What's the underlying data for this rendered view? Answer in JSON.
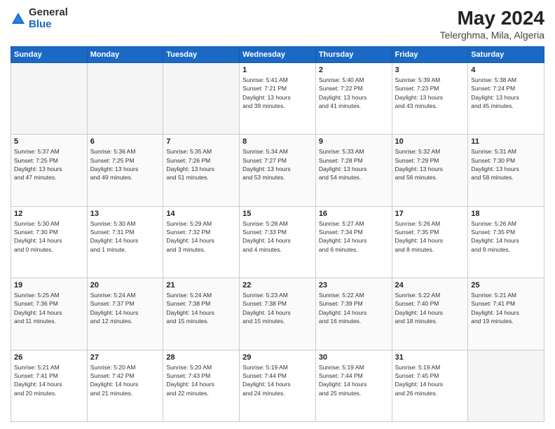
{
  "logo": {
    "general": "General",
    "blue": "Blue"
  },
  "title": "May 2024",
  "subtitle": "Telerghma, Mila, Algeria",
  "weekdays": [
    "Sunday",
    "Monday",
    "Tuesday",
    "Wednesday",
    "Thursday",
    "Friday",
    "Saturday"
  ],
  "weeks": [
    [
      {
        "day": "",
        "info": ""
      },
      {
        "day": "",
        "info": ""
      },
      {
        "day": "",
        "info": ""
      },
      {
        "day": "1",
        "info": "Sunrise: 5:41 AM\nSunset: 7:21 PM\nDaylight: 13 hours\nand 39 minutes."
      },
      {
        "day": "2",
        "info": "Sunrise: 5:40 AM\nSunset: 7:22 PM\nDaylight: 13 hours\nand 41 minutes."
      },
      {
        "day": "3",
        "info": "Sunrise: 5:39 AM\nSunset: 7:23 PM\nDaylight: 13 hours\nand 43 minutes."
      },
      {
        "day": "4",
        "info": "Sunrise: 5:38 AM\nSunset: 7:24 PM\nDaylight: 13 hours\nand 45 minutes."
      }
    ],
    [
      {
        "day": "5",
        "info": "Sunrise: 5:37 AM\nSunset: 7:25 PM\nDaylight: 13 hours\nand 47 minutes."
      },
      {
        "day": "6",
        "info": "Sunrise: 5:36 AM\nSunset: 7:25 PM\nDaylight: 13 hours\nand 49 minutes."
      },
      {
        "day": "7",
        "info": "Sunrise: 5:35 AM\nSunset: 7:26 PM\nDaylight: 13 hours\nand 51 minutes."
      },
      {
        "day": "8",
        "info": "Sunrise: 5:34 AM\nSunset: 7:27 PM\nDaylight: 13 hours\nand 53 minutes."
      },
      {
        "day": "9",
        "info": "Sunrise: 5:33 AM\nSunset: 7:28 PM\nDaylight: 13 hours\nand 54 minutes."
      },
      {
        "day": "10",
        "info": "Sunrise: 5:32 AM\nSunset: 7:29 PM\nDaylight: 13 hours\nand 56 minutes."
      },
      {
        "day": "11",
        "info": "Sunrise: 5:31 AM\nSunset: 7:30 PM\nDaylight: 13 hours\nand 58 minutes."
      }
    ],
    [
      {
        "day": "12",
        "info": "Sunrise: 5:30 AM\nSunset: 7:30 PM\nDaylight: 14 hours\nand 0 minutes."
      },
      {
        "day": "13",
        "info": "Sunrise: 5:30 AM\nSunset: 7:31 PM\nDaylight: 14 hours\nand 1 minute."
      },
      {
        "day": "14",
        "info": "Sunrise: 5:29 AM\nSunset: 7:32 PM\nDaylight: 14 hours\nand 3 minutes."
      },
      {
        "day": "15",
        "info": "Sunrise: 5:28 AM\nSunset: 7:33 PM\nDaylight: 14 hours\nand 4 minutes."
      },
      {
        "day": "16",
        "info": "Sunrise: 5:27 AM\nSunset: 7:34 PM\nDaylight: 14 hours\nand 6 minutes."
      },
      {
        "day": "17",
        "info": "Sunrise: 5:26 AM\nSunset: 7:35 PM\nDaylight: 14 hours\nand 8 minutes."
      },
      {
        "day": "18",
        "info": "Sunrise: 5:26 AM\nSunset: 7:35 PM\nDaylight: 14 hours\nand 9 minutes."
      }
    ],
    [
      {
        "day": "19",
        "info": "Sunrise: 5:25 AM\nSunset: 7:36 PM\nDaylight: 14 hours\nand 11 minutes."
      },
      {
        "day": "20",
        "info": "Sunrise: 5:24 AM\nSunset: 7:37 PM\nDaylight: 14 hours\nand 12 minutes."
      },
      {
        "day": "21",
        "info": "Sunrise: 5:24 AM\nSunset: 7:38 PM\nDaylight: 14 hours\nand 15 minutes."
      },
      {
        "day": "22",
        "info": "Sunrise: 5:23 AM\nSunset: 7:38 PM\nDaylight: 14 hours\nand 15 minutes."
      },
      {
        "day": "23",
        "info": "Sunrise: 5:22 AM\nSunset: 7:39 PM\nDaylight: 14 hours\nand 16 minutes."
      },
      {
        "day": "24",
        "info": "Sunrise: 5:22 AM\nSunset: 7:40 PM\nDaylight: 14 hours\nand 18 minutes."
      },
      {
        "day": "25",
        "info": "Sunrise: 5:21 AM\nSunset: 7:41 PM\nDaylight: 14 hours\nand 19 minutes."
      }
    ],
    [
      {
        "day": "26",
        "info": "Sunrise: 5:21 AM\nSunset: 7:41 PM\nDaylight: 14 hours\nand 20 minutes."
      },
      {
        "day": "27",
        "info": "Sunrise: 5:20 AM\nSunset: 7:42 PM\nDaylight: 14 hours\nand 21 minutes."
      },
      {
        "day": "28",
        "info": "Sunrise: 5:20 AM\nSunset: 7:43 PM\nDaylight: 14 hours\nand 22 minutes."
      },
      {
        "day": "29",
        "info": "Sunrise: 5:19 AM\nSunset: 7:44 PM\nDaylight: 14 hours\nand 24 minutes."
      },
      {
        "day": "30",
        "info": "Sunrise: 5:19 AM\nSunset: 7:44 PM\nDaylight: 14 hours\nand 25 minutes."
      },
      {
        "day": "31",
        "info": "Sunrise: 5:19 AM\nSunset: 7:45 PM\nDaylight: 14 hours\nand 26 minutes."
      },
      {
        "day": "",
        "info": ""
      }
    ]
  ]
}
